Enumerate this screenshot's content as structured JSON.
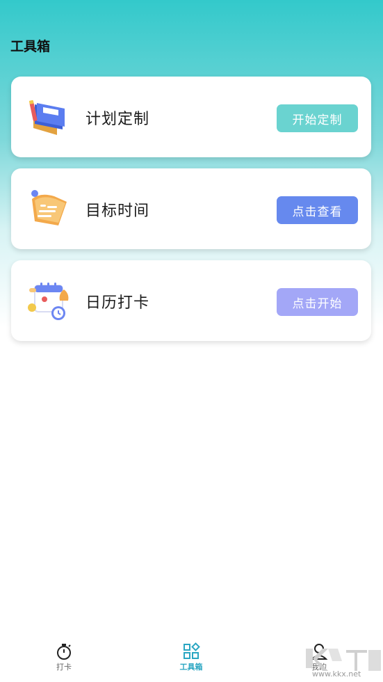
{
  "header": {
    "title": "工具箱"
  },
  "cards": [
    {
      "title": "计划定制",
      "button": "开始定制",
      "icon": "notebook-icon",
      "button_color": "#6ad3d0"
    },
    {
      "title": "目标时间",
      "button": "点击查看",
      "icon": "scroll-icon",
      "button_color": "#6689ee"
    },
    {
      "title": "日历打卡",
      "button": "点击开始",
      "icon": "calendar-icon",
      "button_color": "#a3a7f7"
    }
  ],
  "tabbar": {
    "items": [
      {
        "label": "打卡",
        "icon": "stopwatch-icon",
        "active": false
      },
      {
        "label": "工具箱",
        "icon": "grid-icon",
        "active": true
      },
      {
        "label": "我的",
        "icon": "person-icon",
        "active": false
      }
    ]
  },
  "watermark": {
    "text": "www.kkx.net"
  },
  "colors": {
    "accent": "#2aa6c2",
    "header_gradient_top": "#33c9cb"
  }
}
